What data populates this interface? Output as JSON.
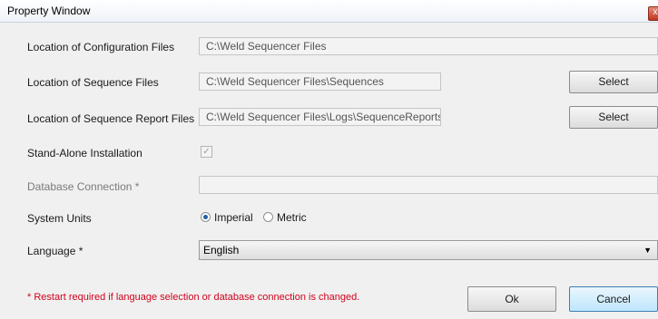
{
  "window": {
    "title": "Property Window",
    "close_glyph": "x"
  },
  "fields": {
    "config_files": {
      "label": "Location of Configuration Files",
      "value": "C:\\Weld Sequencer Files"
    },
    "sequence_files": {
      "label": "Location of Sequence Files",
      "value": "C:\\Weld Sequencer Files\\Sequences",
      "button": "Select"
    },
    "report_files": {
      "label": "Location of Sequence Report Files",
      "value": "C:\\Weld Sequencer Files\\Logs\\SequenceReports",
      "button": "Select"
    },
    "standalone": {
      "label": "Stand-Alone Installation",
      "checked": true,
      "check_glyph": "✓"
    },
    "database": {
      "label": "Database Connection *",
      "value": ""
    },
    "units": {
      "label": "System Units",
      "options": [
        "Imperial",
        "Metric"
      ],
      "selected": "Imperial"
    },
    "language": {
      "label": "Language *",
      "value": "English"
    }
  },
  "footer": {
    "note": "* Restart required if language selection or database connection is changed.",
    "ok": "Ok",
    "cancel": "Cancel"
  },
  "colors": {
    "note": "#d0021b",
    "accent": "#3c7fb1"
  }
}
